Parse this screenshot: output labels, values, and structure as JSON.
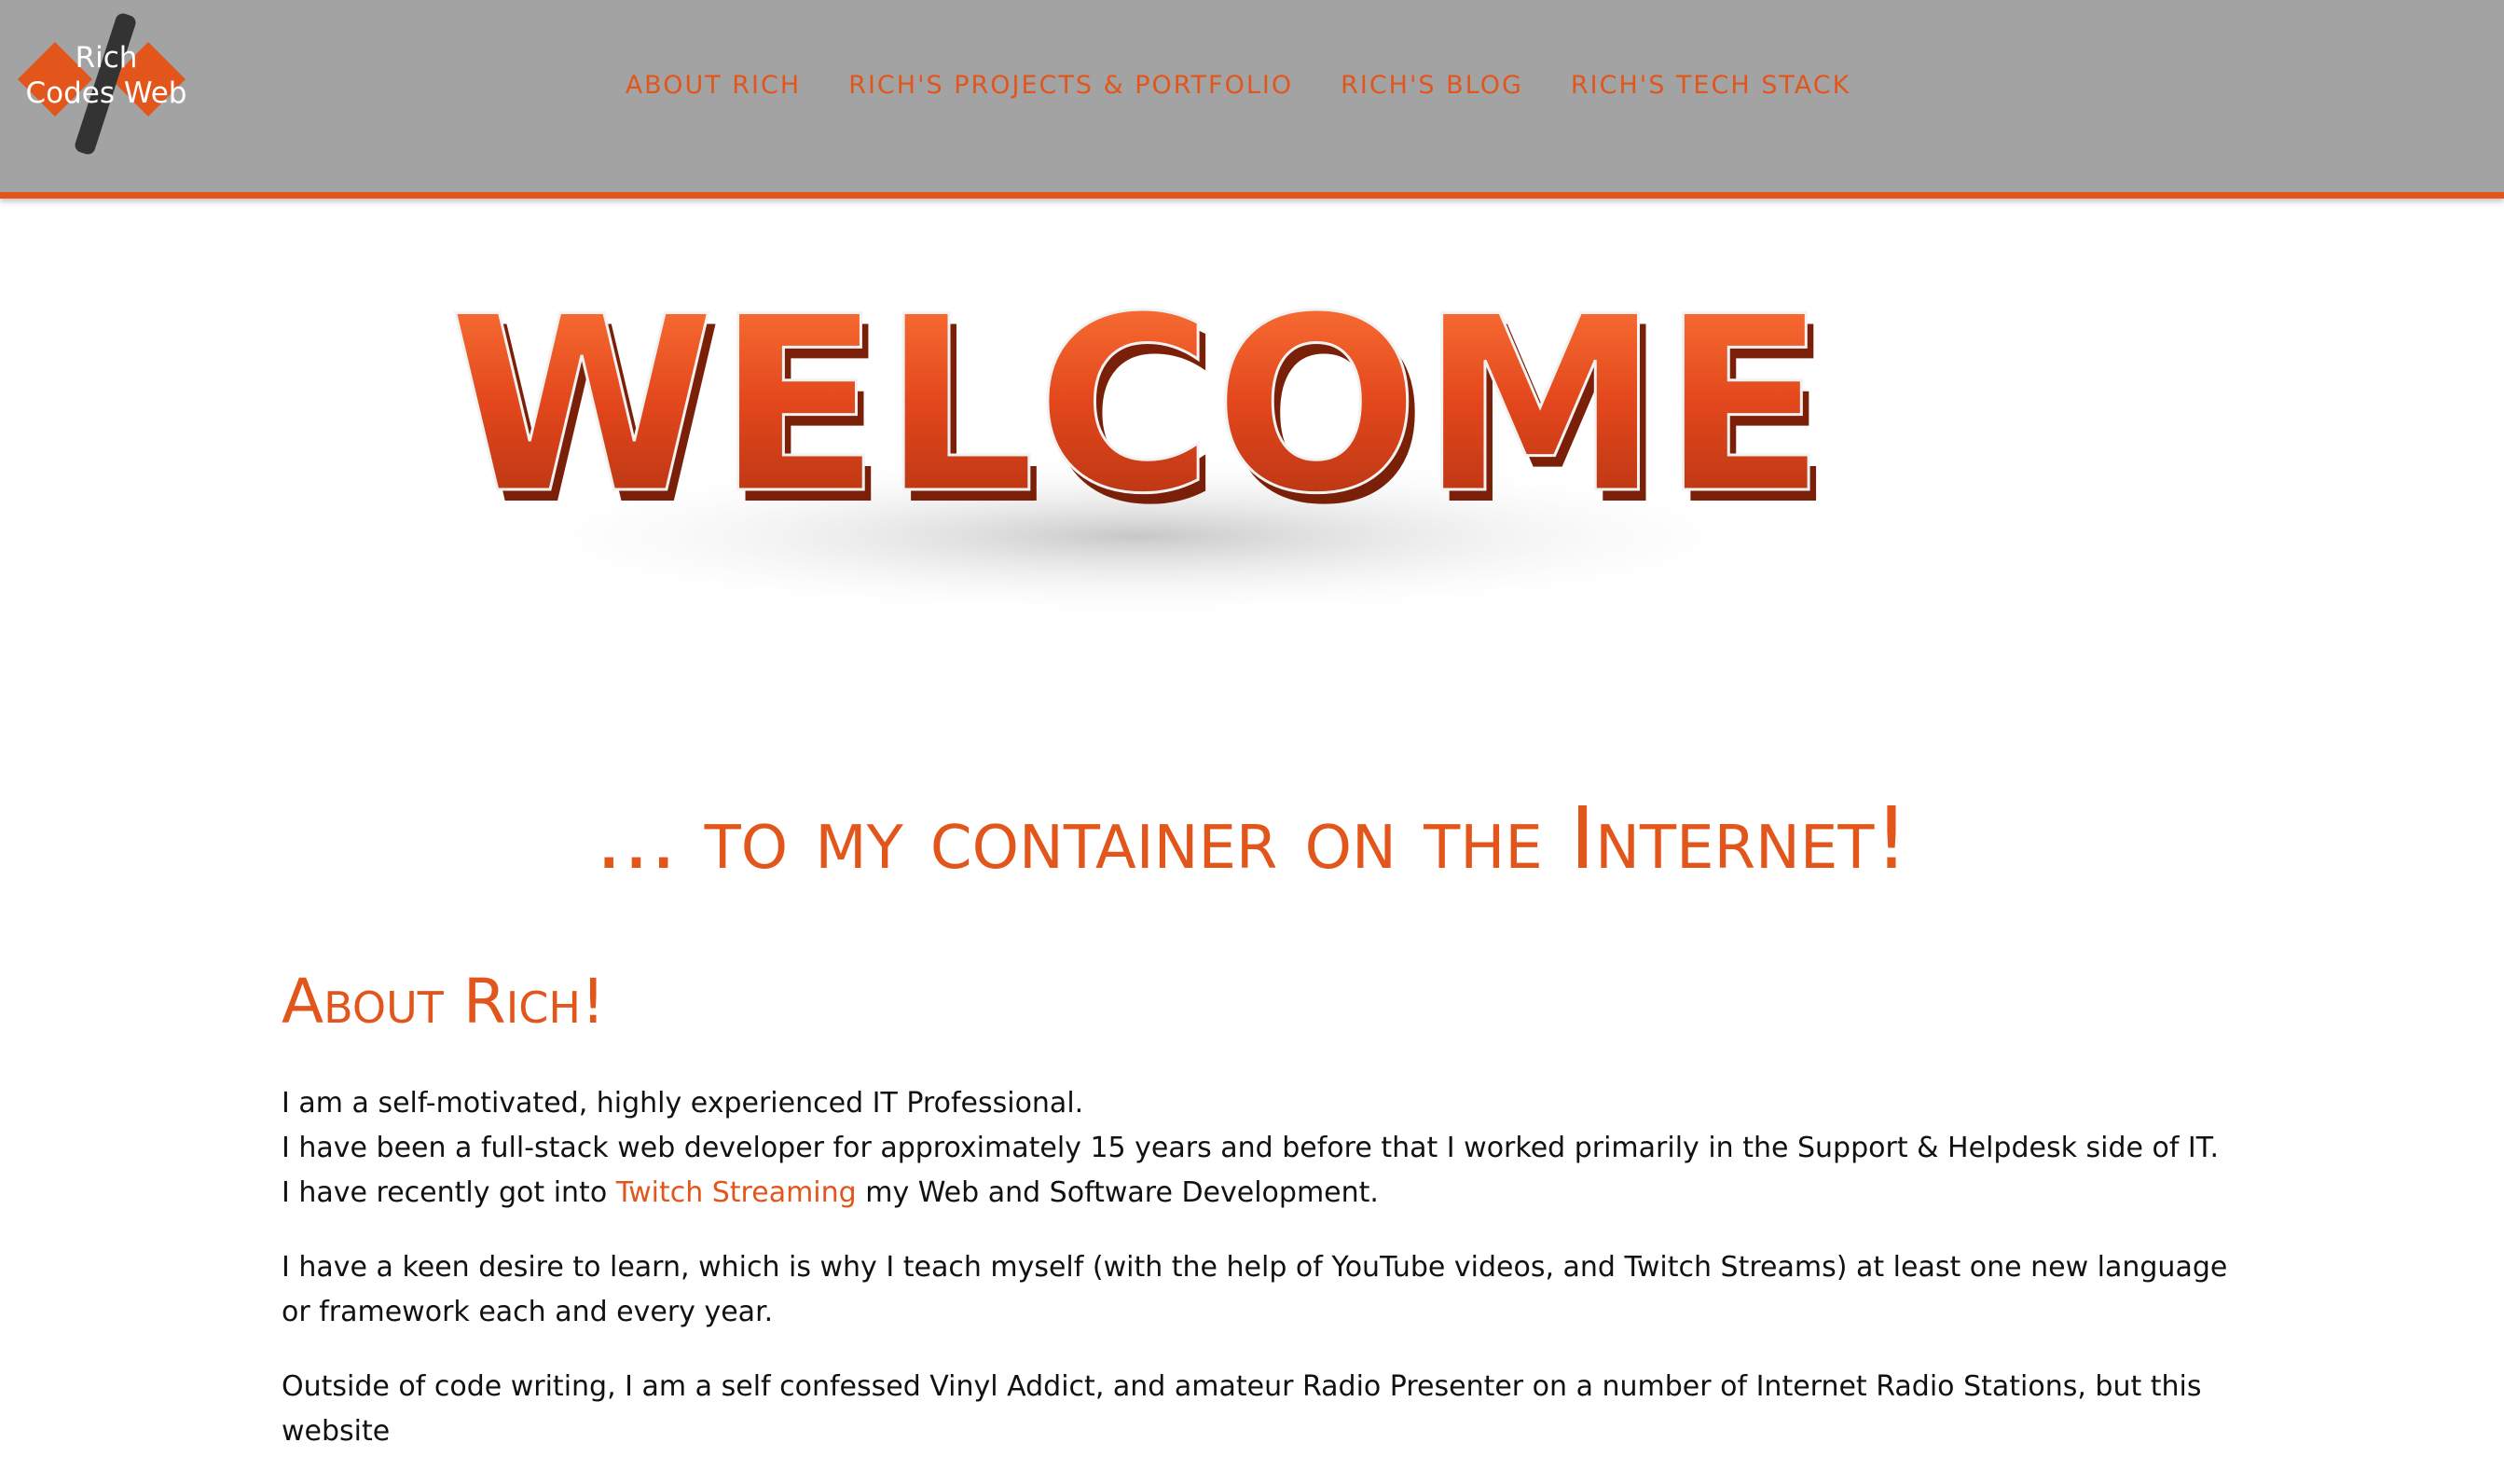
{
  "logo": {
    "line1": "Rich",
    "line2": "Codes Web",
    "colors": {
      "diamond": "#e2561c",
      "slash": "#333333"
    }
  },
  "nav": {
    "items": [
      {
        "label": "ABOUT RICH"
      },
      {
        "label": "RICH'S PROJECTS & PORTFOLIO"
      },
      {
        "label": "RICH'S BLOG"
      },
      {
        "label": "RICH'S TECH STACK"
      }
    ]
  },
  "hero": {
    "word": "WELCOME"
  },
  "tagline": "... to my container on the Internet!",
  "about": {
    "title": "About Rich!",
    "p1_line1": "I am a self-motivated, highly experienced IT Professional.",
    "p1_line2": "I have been a full-stack web developer for approximately 15 years and before that I worked primarily in the Support & Helpdesk side of IT.",
    "p1_line3_pre": "I have recently got into ",
    "p1_line3_link": "Twitch Streaming",
    "p1_line3_post": " my Web and Software Development.",
    "p2": "I have a keen desire to learn, which is why I teach myself (with the help of YouTube videos, and Twitch Streams) at least one new language or framework each and every year.",
    "p3": "Outside of code writing, I am a self confessed Vinyl Addict, and amateur Radio Presenter on a number of Internet Radio Stations, but this website"
  },
  "colors": {
    "accent": "#e2561c",
    "header_bg": "#a3a3a3",
    "text": "#111111"
  }
}
